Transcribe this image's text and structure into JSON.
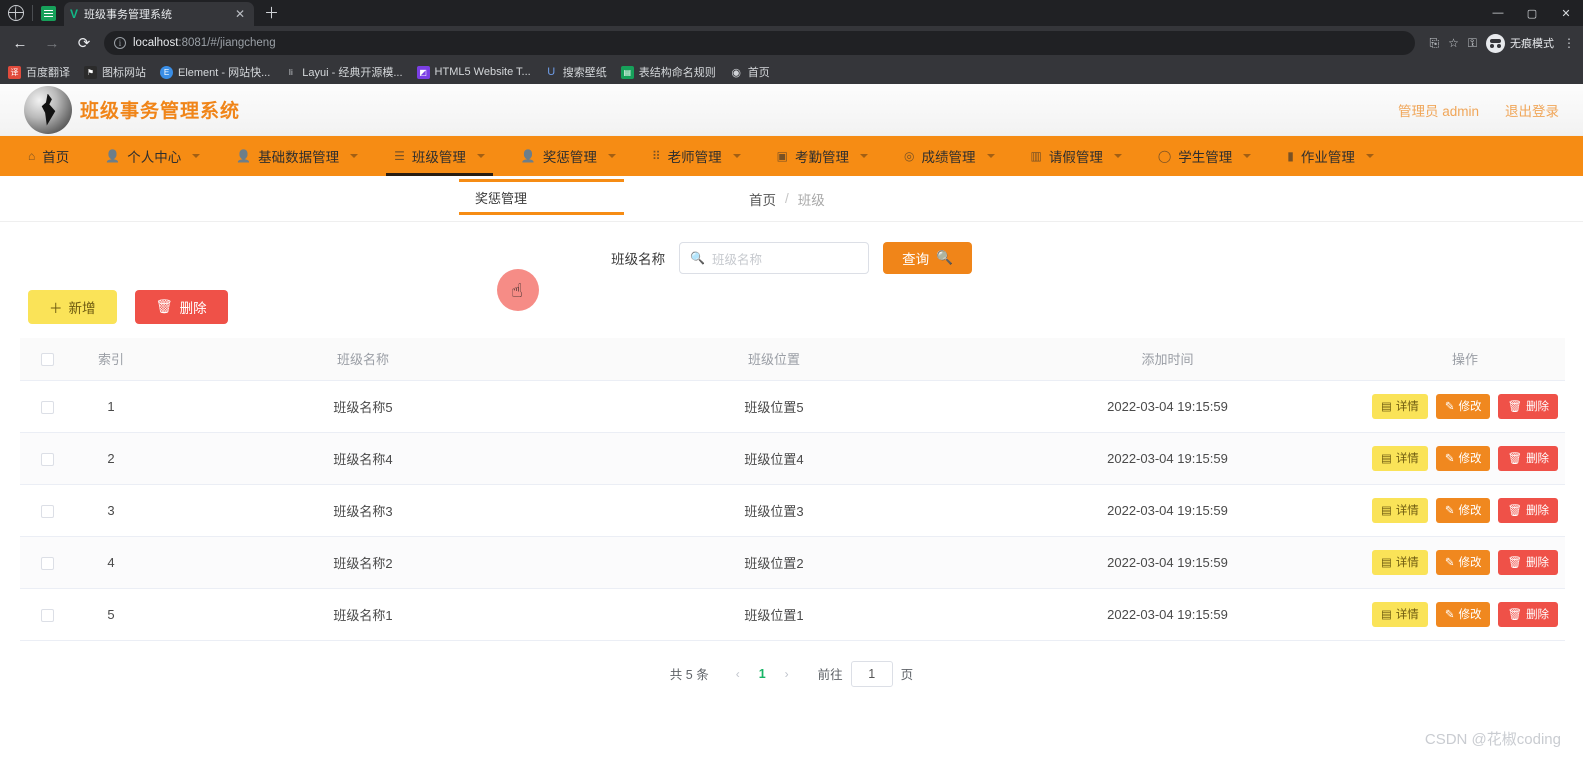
{
  "browser": {
    "tab": {
      "title": "班级事务管理系统",
      "favicon": "v-logo-icon",
      "close": "✕"
    },
    "newtab_label": "＋",
    "nav": {
      "back": "←",
      "forward": "→",
      "reload": "⟳"
    },
    "url": {
      "host": "localhost",
      "rest": ":8081/#/jiangcheng"
    },
    "incognito_label": "无痕模式",
    "window": {
      "minimize": "—",
      "maximize": "▢",
      "close": "✕"
    },
    "bookmarks": [
      {
        "label": "百度翻译",
        "color": "#e04b3c",
        "glyph": "译"
      },
      {
        "label": "图标网站",
        "color": "#2b2b2b",
        "glyph": "⚑"
      },
      {
        "label": "Element - 网站快...",
        "color": "#3a8ee6",
        "glyph": "E"
      },
      {
        "label": "Layui - 经典开源模...",
        "color": "#4a4f57",
        "glyph": "Ii"
      },
      {
        "label": "HTML5 Website T...",
        "color": "#7b3fe4",
        "glyph": "◩"
      },
      {
        "label": "搜索壁纸",
        "color": "#4a7fd4",
        "glyph": "U"
      },
      {
        "label": "表结构命名规则",
        "color": "#17a05a",
        "glyph": "▤"
      },
      {
        "label": "首页",
        "color": "#3c3f44",
        "glyph": "◉"
      }
    ]
  },
  "app": {
    "title": "班级事务管理系统",
    "user_label": "管理员 admin",
    "logout_label": "退出登录",
    "nav_items": [
      {
        "label": "首页",
        "icon": "home-icon",
        "glyph": "⌂",
        "active": false,
        "caret": false
      },
      {
        "label": "个人中心",
        "icon": "user-icon",
        "glyph": "👤",
        "active": false,
        "caret": true
      },
      {
        "label": "基础数据管理",
        "icon": "user-icon",
        "glyph": "👤",
        "active": false,
        "caret": true
      },
      {
        "label": "班级管理",
        "icon": "list-icon",
        "glyph": "☰",
        "active": true,
        "caret": true
      },
      {
        "label": "奖惩管理",
        "icon": "user-icon",
        "glyph": "👤",
        "active": false,
        "caret": true
      },
      {
        "label": "老师管理",
        "icon": "grid-icon",
        "glyph": "⠿",
        "active": false,
        "caret": true
      },
      {
        "label": "考勤管理",
        "icon": "calendar-icon",
        "glyph": "▣",
        "active": false,
        "caret": true
      },
      {
        "label": "成绩管理",
        "icon": "target-icon",
        "glyph": "◎",
        "active": false,
        "caret": true
      },
      {
        "label": "请假管理",
        "icon": "doc-icon",
        "glyph": "▥",
        "active": false,
        "caret": true
      },
      {
        "label": "学生管理",
        "icon": "circle-icon",
        "glyph": "◯",
        "active": false,
        "caret": true
      },
      {
        "label": "作业管理",
        "icon": "chart-icon",
        "glyph": "▮",
        "active": false,
        "caret": true
      }
    ],
    "view_tab_label": "奖惩管理",
    "breadcrumb": {
      "home": "首页",
      "separator": "/",
      "current": "班级"
    },
    "search": {
      "label": "班级名称",
      "placeholder": "班级名称",
      "value": "",
      "button_label": "查询",
      "button_icon": "search-icon"
    },
    "actions": {
      "add_label": "新增",
      "add_icon": "plus-icon",
      "delete_label": "删除",
      "delete_icon": "trash-icon"
    },
    "table": {
      "headers": [
        "",
        "索引",
        "班级名称",
        "班级位置",
        "添加时间",
        "操作"
      ],
      "rows": [
        {
          "index": "1",
          "name": "班级名称5",
          "position": "班级位置5",
          "time": "2022-03-04 19:15:59"
        },
        {
          "index": "2",
          "name": "班级名称4",
          "position": "班级位置4",
          "time": "2022-03-04 19:15:59"
        },
        {
          "index": "3",
          "name": "班级名称3",
          "position": "班级位置3",
          "time": "2022-03-04 19:15:59"
        },
        {
          "index": "4",
          "name": "班级名称2",
          "position": "班级位置2",
          "time": "2022-03-04 19:15:59"
        },
        {
          "index": "5",
          "name": "班级名称1",
          "position": "班级位置1",
          "time": "2022-03-04 19:15:59"
        }
      ],
      "ops": {
        "detail_label": "详情",
        "detail_icon": "doc-icon",
        "edit_label": "修改",
        "edit_icon": "pencil-icon",
        "delete_label": "删除",
        "delete_icon": "trash-icon"
      }
    },
    "pagination": {
      "total_text": "共 5 条",
      "prev": "‹",
      "next": "›",
      "current_page": "1",
      "goto_label": "前往",
      "goto_value": "1",
      "page_unit": "页"
    },
    "watermark": "CSDN @花椒coding",
    "colors": {
      "brand_orange": "#f68c14",
      "title_orange": "#f08519",
      "yellow": "#fae358",
      "red": "#ef5148",
      "green": "#18b566"
    }
  }
}
